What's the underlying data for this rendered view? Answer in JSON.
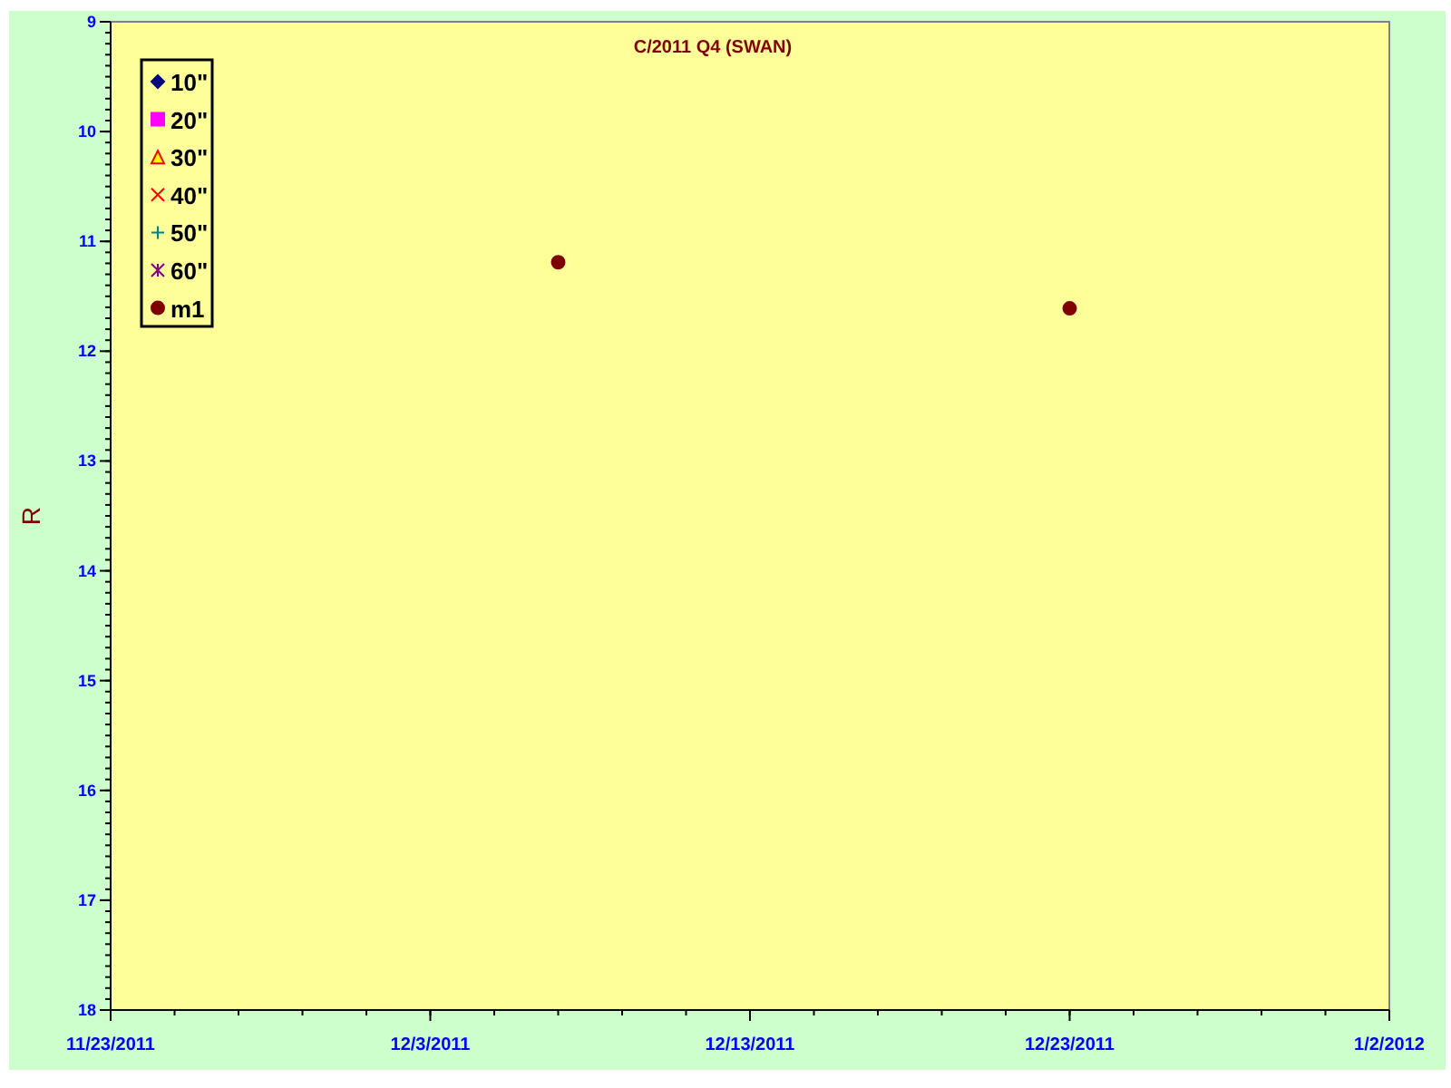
{
  "chart_data": {
    "type": "scatter",
    "title": "C/2011 Q4 (SWAN)",
    "ylabel": "R",
    "categories": [
      "11/23/2011",
      null,
      null,
      null,
      null,
      null,
      null,
      null,
      null,
      null,
      "12/3/2011",
      null,
      null,
      null,
      null,
      null,
      null,
      null,
      null,
      null,
      "12/13/2011",
      null,
      null,
      null,
      null,
      null,
      null,
      null,
      null,
      null,
      "12/23/2011",
      null,
      null,
      null,
      null,
      null,
      null,
      null,
      null,
      null,
      "1/2/2012"
    ],
    "ylim": [
      18,
      9
    ],
    "yticks": [
      9,
      10,
      11,
      12,
      13,
      14,
      15,
      16,
      17,
      18
    ],
    "series": [
      {
        "name": "10\"",
        "color": "#000080",
        "values": [
          null,
          null,
          null,
          null,
          null,
          null,
          null,
          null,
          null,
          null,
          null,
          null,
          null,
          null,
          null,
          null,
          null,
          null,
          null,
          null,
          null,
          null,
          null,
          null,
          null,
          null,
          null,
          null,
          null,
          null,
          null,
          null,
          null,
          null,
          null,
          null,
          null,
          null,
          null,
          null,
          null
        ]
      },
      {
        "name": "20\"",
        "color": "#ff00ff",
        "values": [
          null,
          null,
          null,
          null,
          null,
          null,
          null,
          null,
          null,
          null,
          null,
          null,
          null,
          null,
          null,
          null,
          null,
          null,
          null,
          null,
          null,
          null,
          null,
          null,
          null,
          null,
          null,
          null,
          null,
          null,
          null,
          null,
          null,
          null,
          null,
          null,
          null,
          null,
          null,
          null,
          null
        ]
      },
      {
        "name": "30\"",
        "color": "#ffff00",
        "values": [
          null,
          null,
          null,
          null,
          null,
          null,
          null,
          null,
          null,
          null,
          null,
          null,
          null,
          null,
          null,
          null,
          null,
          null,
          null,
          null,
          null,
          null,
          null,
          null,
          null,
          null,
          null,
          null,
          null,
          null,
          null,
          null,
          null,
          null,
          null,
          null,
          null,
          null,
          null,
          null,
          null
        ]
      },
      {
        "name": "40\"",
        "color": "#ff0000",
        "values": [
          null,
          null,
          null,
          null,
          null,
          null,
          null,
          null,
          null,
          null,
          null,
          null,
          null,
          null,
          null,
          null,
          null,
          null,
          null,
          null,
          null,
          null,
          null,
          null,
          null,
          null,
          null,
          null,
          null,
          null,
          null,
          null,
          null,
          null,
          null,
          null,
          null,
          null,
          null,
          null,
          null
        ]
      },
      {
        "name": "50\"",
        "color": "#008080",
        "values": [
          null,
          null,
          null,
          null,
          null,
          null,
          null,
          null,
          null,
          null,
          null,
          null,
          null,
          null,
          null,
          null,
          null,
          null,
          null,
          null,
          null,
          null,
          null,
          null,
          null,
          null,
          null,
          null,
          null,
          null,
          null,
          null,
          null,
          null,
          null,
          null,
          null,
          null,
          null,
          null,
          null
        ]
      },
      {
        "name": "60\"",
        "color": "#800080",
        "values": [
          null,
          null,
          null,
          null,
          null,
          null,
          null,
          null,
          null,
          null,
          null,
          null,
          null,
          null,
          null,
          null,
          null,
          null,
          null,
          null,
          null,
          null,
          null,
          null,
          null,
          null,
          null,
          null,
          null,
          null,
          null,
          null,
          null,
          null,
          null,
          null,
          null,
          null,
          null,
          null,
          null
        ]
      },
      {
        "name": "m1",
        "color": "#800000",
        "values": [
          null,
          null,
          null,
          null,
          null,
          null,
          null,
          null,
          null,
          null,
          null,
          null,
          null,
          null,
          11.19,
          null,
          null,
          null,
          null,
          null,
          null,
          null,
          null,
          null,
          null,
          null,
          null,
          null,
          null,
          null,
          11.61,
          null,
          null,
          null,
          null,
          null,
          null,
          null,
          null,
          null,
          null
        ]
      }
    ]
  }
}
